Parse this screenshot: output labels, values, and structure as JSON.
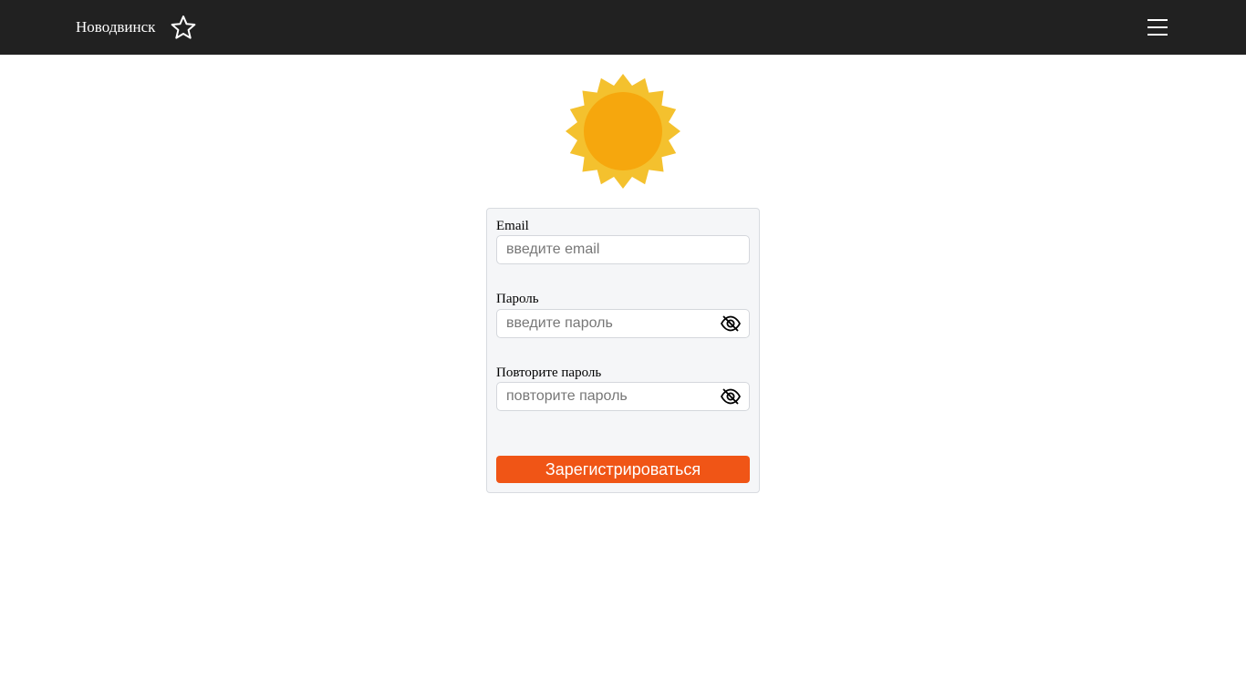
{
  "header": {
    "city": "Новодвинск",
    "favorite_icon": "star-outline-icon",
    "menu_icon": "hamburger-menu-icon",
    "background": "#212121"
  },
  "logo": {
    "icon": "sun-icon",
    "ray_color": "#f4c12e",
    "disc_color": "#f6a70d"
  },
  "form": {
    "email": {
      "label": "Email",
      "placeholder": "введите email",
      "value": ""
    },
    "password": {
      "label": "Пароль",
      "placeholder": "введите пароль",
      "value": "",
      "toggle_icon": "eye-off-icon"
    },
    "password_repeat": {
      "label": "Повторите пароль",
      "placeholder": "повторите пароль",
      "value": "",
      "toggle_icon": "eye-off-icon"
    },
    "submit_label": "Зарегистрироваться",
    "submit_color": "#f05516"
  }
}
